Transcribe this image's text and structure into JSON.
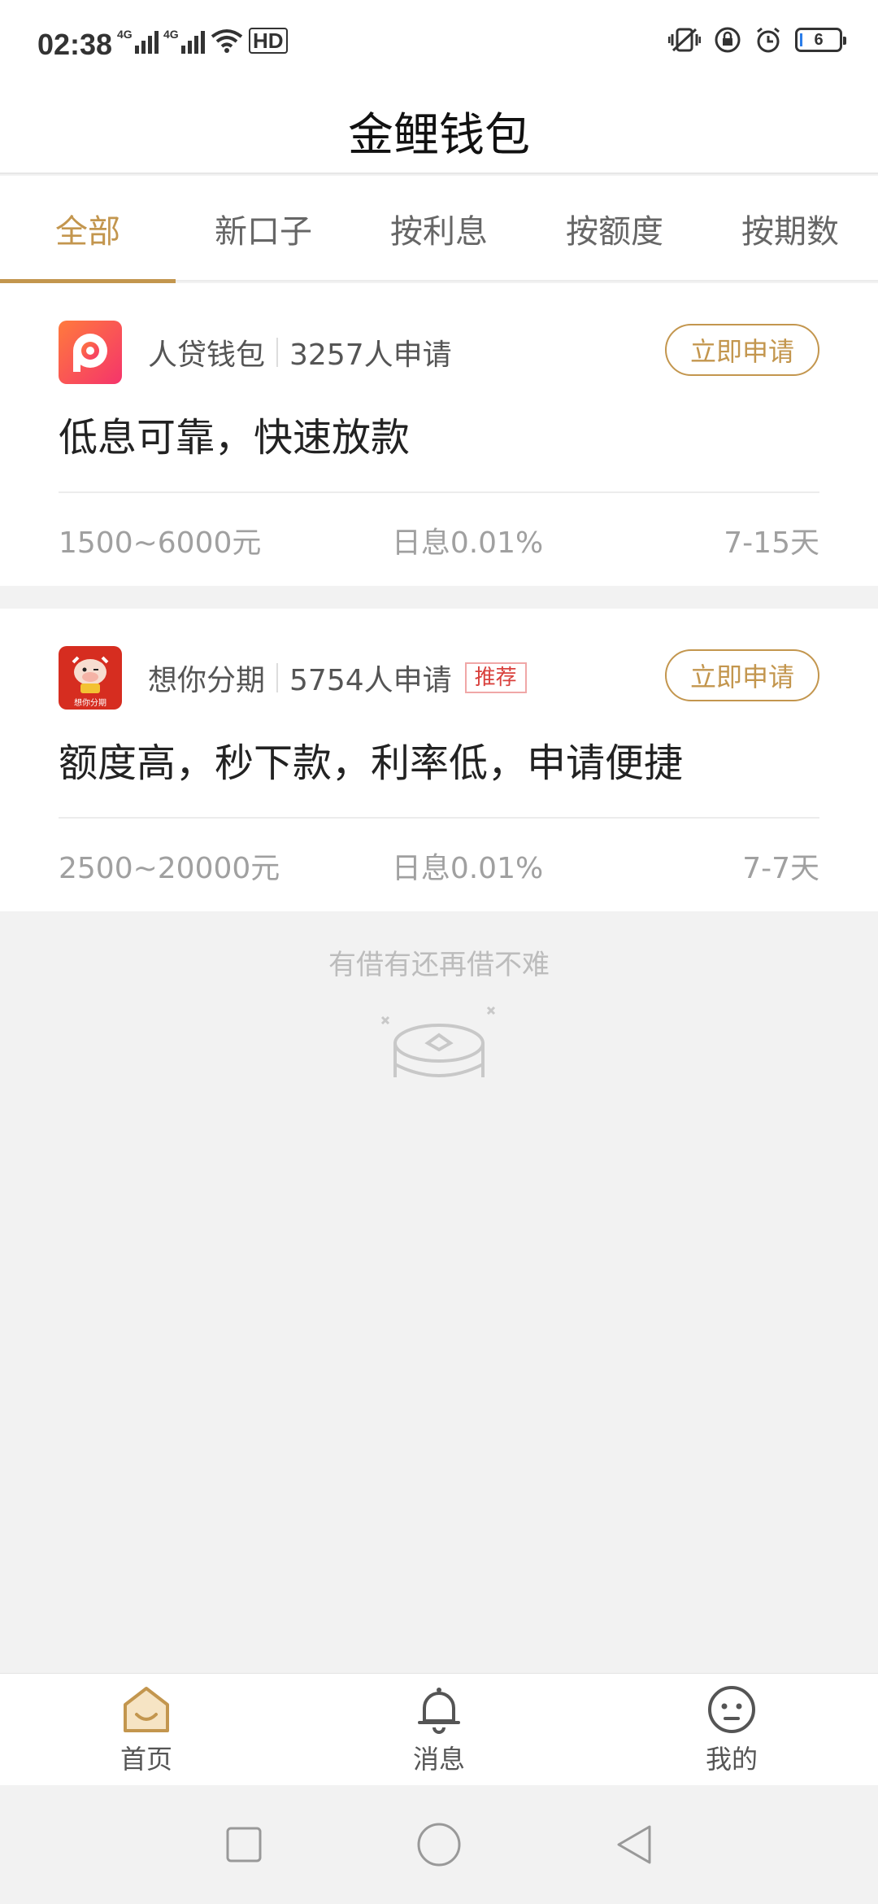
{
  "status_bar": {
    "time": "02:38",
    "network_1": "4G",
    "network_2": "4G",
    "hd_badge": "HD",
    "battery": "6"
  },
  "header": {
    "title": "金鲤钱包"
  },
  "tabs": [
    {
      "label": "全部",
      "active": true
    },
    {
      "label": "新口子",
      "active": false
    },
    {
      "label": "按利息",
      "active": false
    },
    {
      "label": "按额度",
      "active": false
    },
    {
      "label": "按期数",
      "active": false
    }
  ],
  "cards": [
    {
      "name": "人贷钱包",
      "apply_count": "3257人申请",
      "badge": "",
      "button": "立即申请",
      "slogan": "低息可靠，快速放款",
      "amount": "1500~6000元",
      "rate": "日息0.01%",
      "term": "7-15天",
      "logo_icon": "renDai-logo-icon"
    },
    {
      "name": "想你分期",
      "apply_count": "5754人申请",
      "badge": "推荐",
      "button": "立即申请",
      "slogan": "额度高，秒下款，利率低，申请便捷",
      "amount": "2500~20000元",
      "rate": "日息0.01%",
      "term": "7-7天",
      "logo_icon": "xiangni-logo-icon",
      "logo_text": "想你分期"
    }
  ],
  "empty_state": {
    "text": "有借有还再借不难",
    "icon": "coin-box-icon"
  },
  "tab_bar": [
    {
      "label": "首页",
      "icon": "home-icon",
      "active": true
    },
    {
      "label": "消息",
      "icon": "bell-icon",
      "active": false
    },
    {
      "label": "我的",
      "icon": "face-icon",
      "active": false
    }
  ],
  "colors": {
    "accent": "#c3964e",
    "badge_red": "#d9413d",
    "muted": "#a0a0a0",
    "background": "#f2f2f2"
  }
}
